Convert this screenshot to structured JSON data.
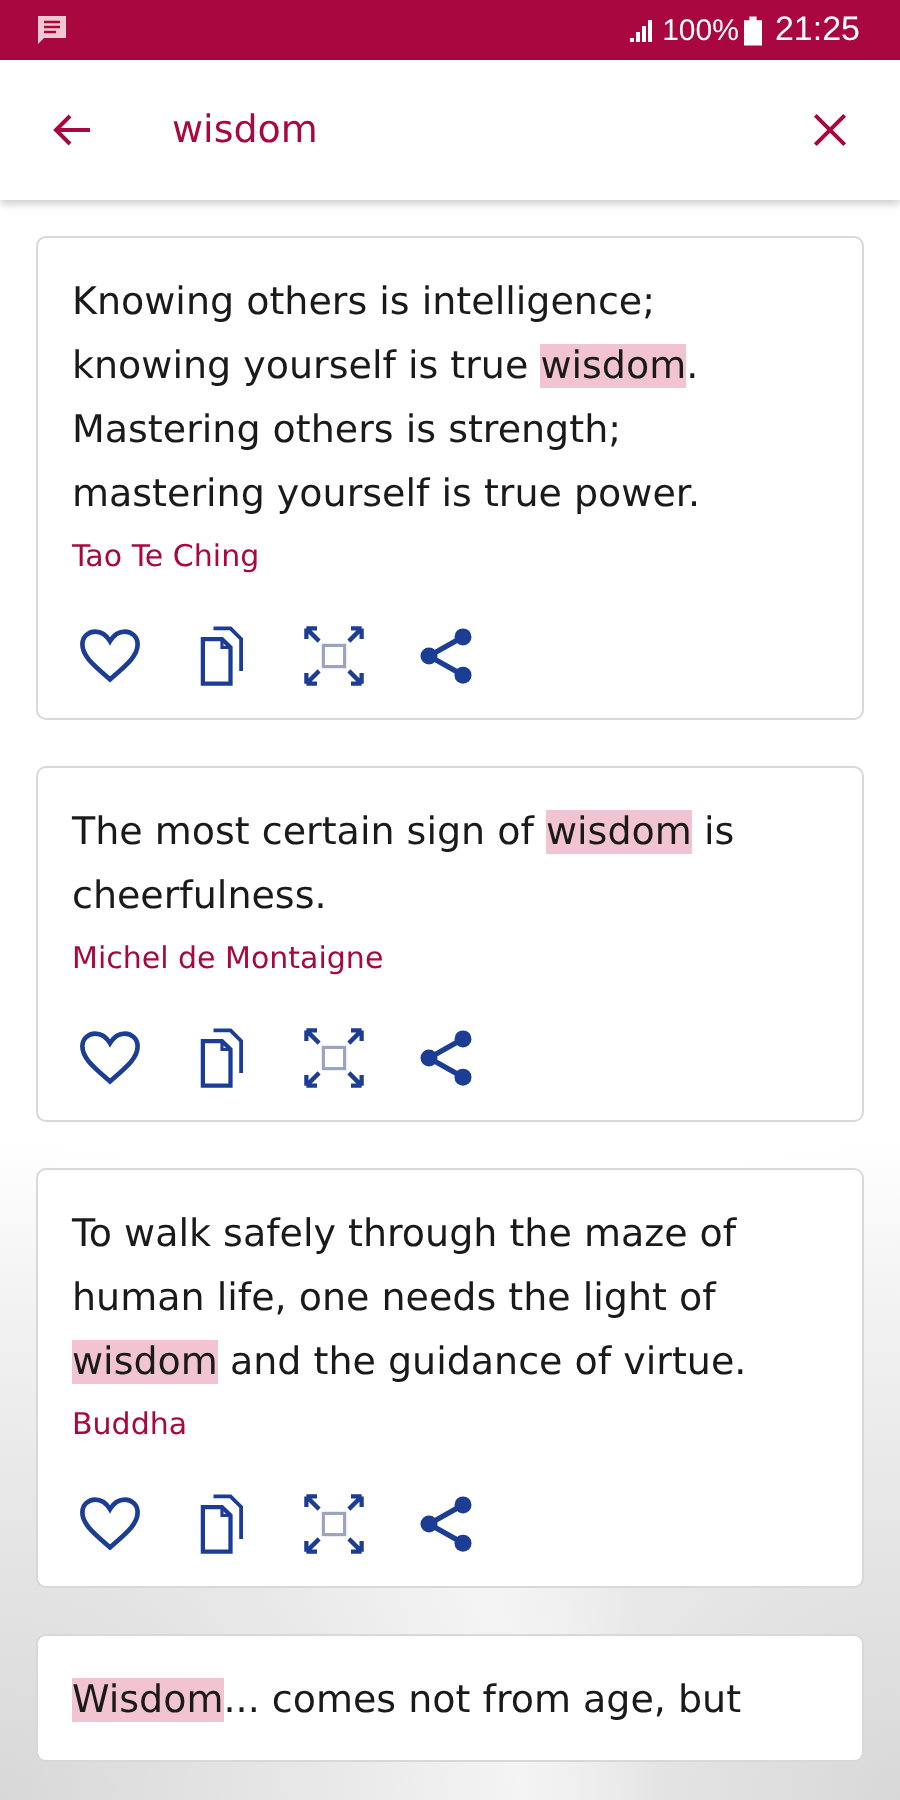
{
  "status_bar": {
    "battery": "100%",
    "time": "21:25"
  },
  "search": {
    "value": "wisdom"
  },
  "quotes": [
    {
      "segments": [
        {
          "text": "Knowing others is intelligence; knowing yourself is true ",
          "highlight": false
        },
        {
          "text": "wisdom",
          "highlight": true
        },
        {
          "text": ". Mastering others is strength; mastering yourself is true power.",
          "highlight": false
        }
      ],
      "author": "Tao Te Ching",
      "favorite": false
    },
    {
      "segments": [
        {
          "text": "The most certain sign of ",
          "highlight": false
        },
        {
          "text": "wisdom",
          "highlight": true
        },
        {
          "text": " is cheerfulness.",
          "highlight": false
        }
      ],
      "author": "Michel de Montaigne",
      "favorite": false
    },
    {
      "segments": [
        {
          "text": "To walk safely through the maze of human life, one needs the light of ",
          "highlight": false
        },
        {
          "text": "wisdom",
          "highlight": true
        },
        {
          "text": " and the guidance of virtue.",
          "highlight": false
        }
      ],
      "author": "Buddha",
      "favorite": false
    },
    {
      "segments": [
        {
          "text": "Wisdom",
          "highlight": true
        },
        {
          "text": "... comes not from age, but",
          "highlight": false
        }
      ]
    }
  ]
}
